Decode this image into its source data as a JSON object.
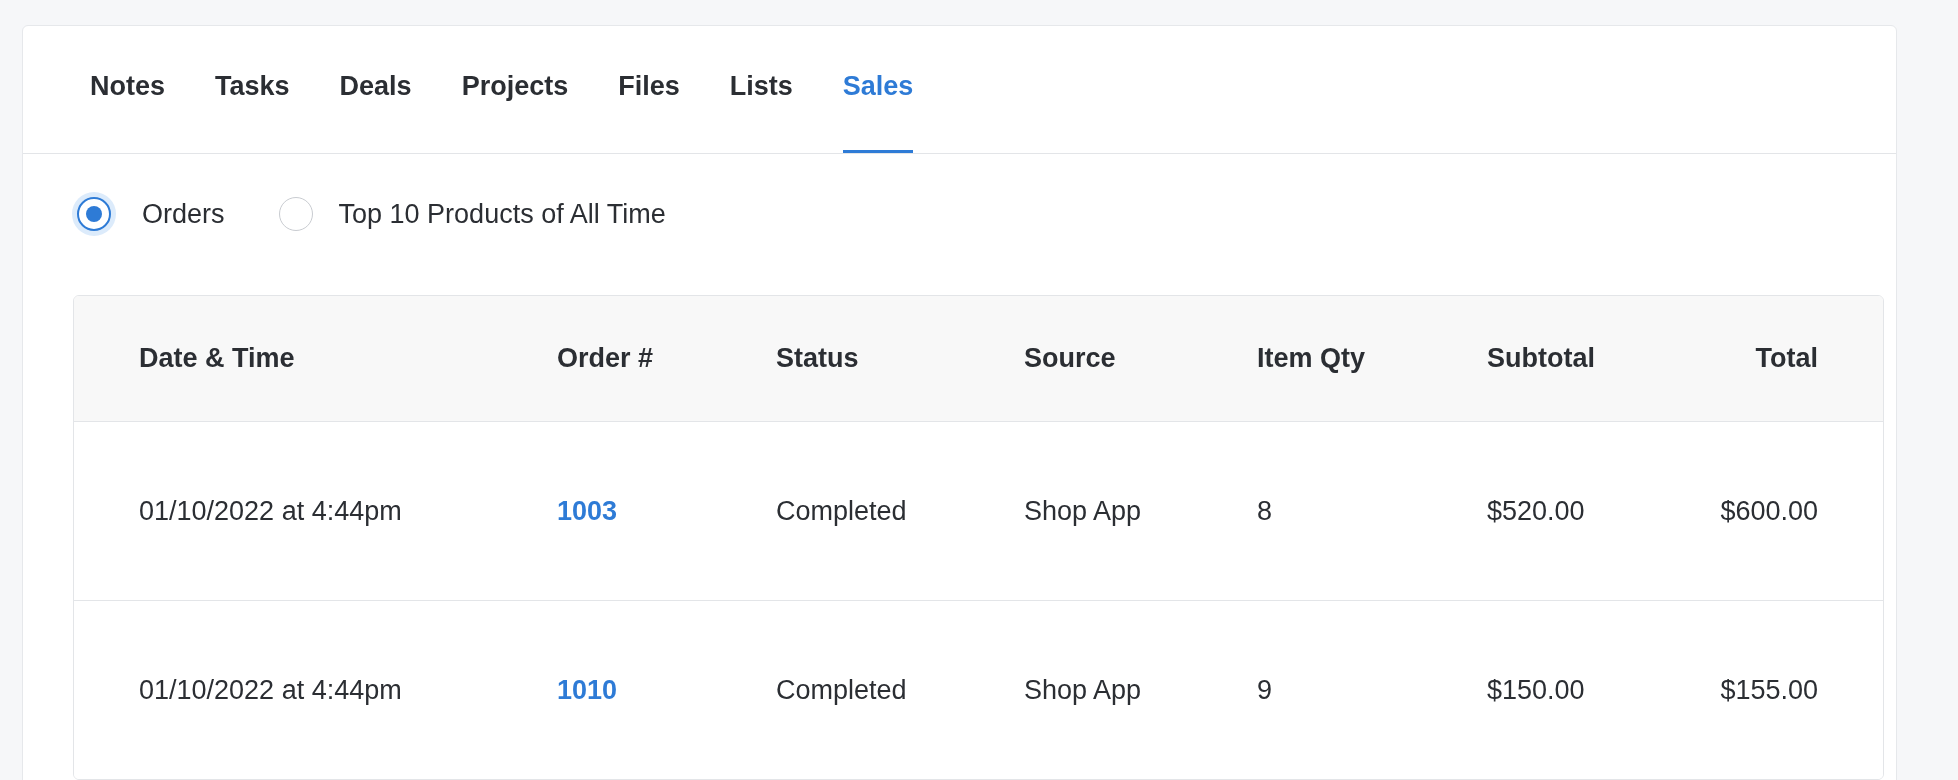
{
  "tabs": [
    {
      "label": "Notes",
      "selected": false
    },
    {
      "label": "Tasks",
      "selected": false
    },
    {
      "label": "Deals",
      "selected": false
    },
    {
      "label": "Projects",
      "selected": false
    },
    {
      "label": "Files",
      "selected": false
    },
    {
      "label": "Lists",
      "selected": false
    },
    {
      "label": "Sales",
      "selected": true
    }
  ],
  "view_options": [
    {
      "label": "Orders",
      "selected": true
    },
    {
      "label": "Top 10 Products of All Time",
      "selected": false
    }
  ],
  "table": {
    "columns": [
      "Date & Time",
      "Order #",
      "Status",
      "Source",
      "Item Qty",
      "Subtotal",
      "Total"
    ],
    "rows": [
      {
        "date_time": "01/10/2022 at 4:44pm",
        "order": "1003",
        "status": "Completed",
        "source": "Shop App",
        "item_qty": "8",
        "subtotal": "$520.00",
        "total": "$600.00"
      },
      {
        "date_time": "01/10/2022 at 4:44pm",
        "order": "1010",
        "status": "Completed",
        "source": "Shop App",
        "item_qty": "9",
        "subtotal": "$150.00",
        "total": "$155.00"
      }
    ]
  }
}
